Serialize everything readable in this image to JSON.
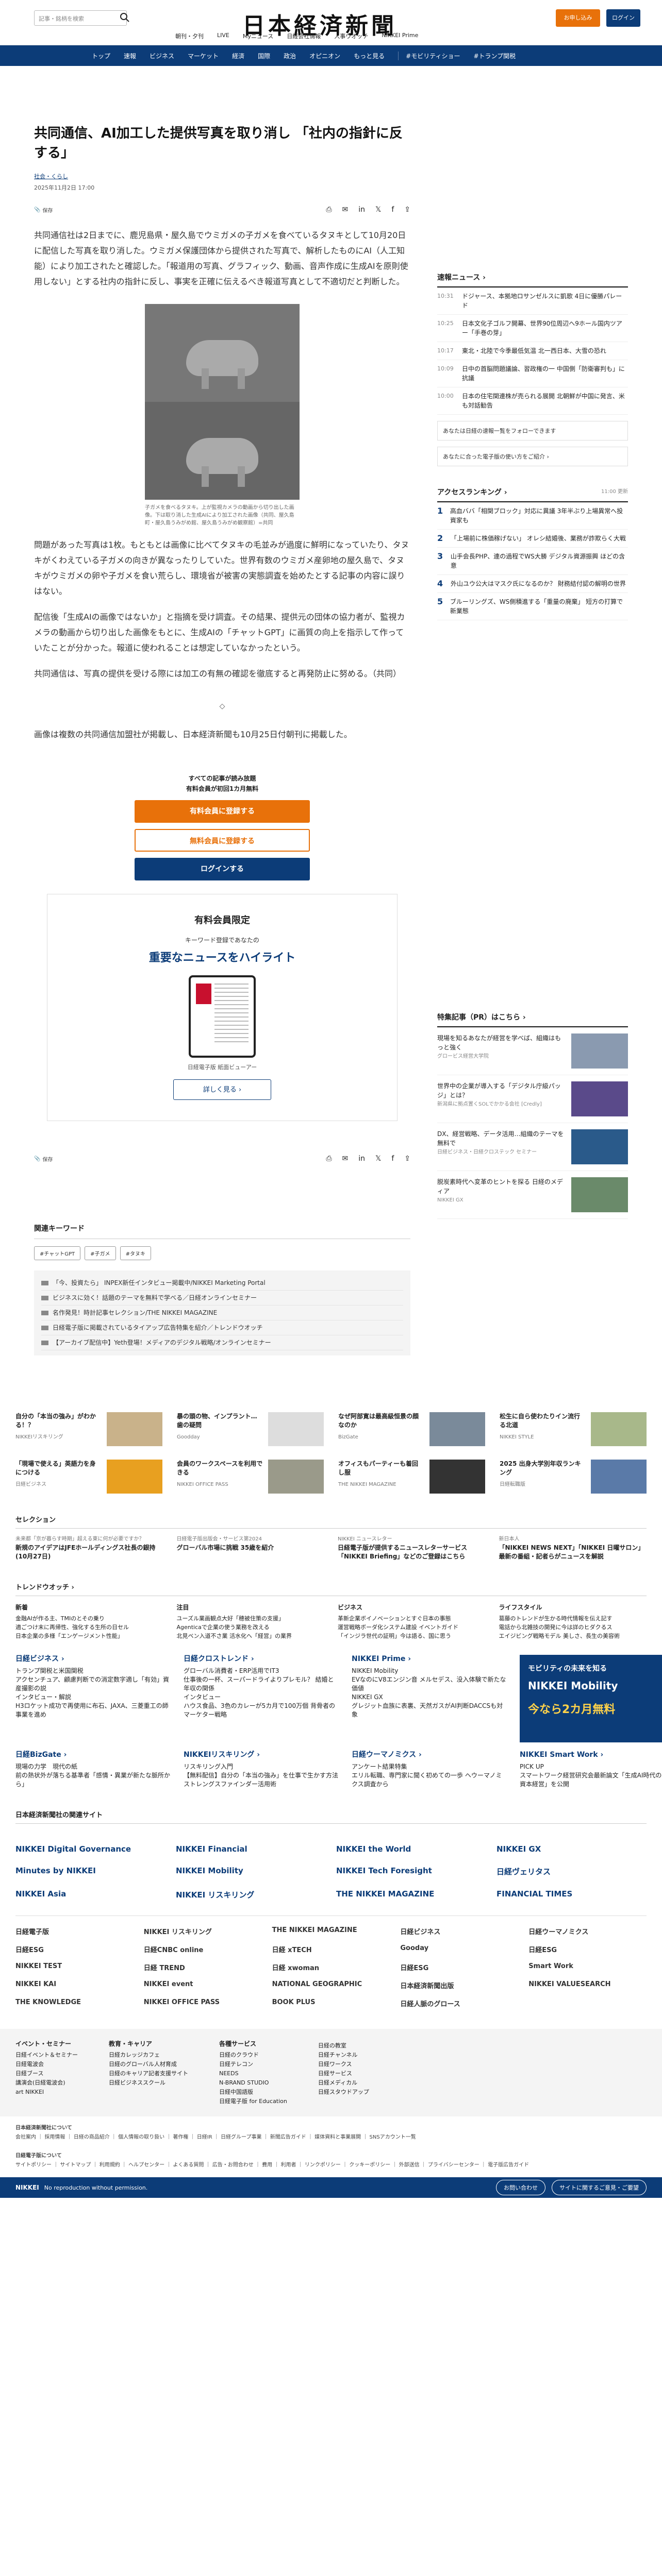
{
  "header": {
    "search_placeholder": "記事・銘柄を検索",
    "logo": "日本経済新聞",
    "signup": "お申し込み",
    "login": "ログイン",
    "service_nav": [
      "朝刊・夕刊",
      "LIVE",
      "Myニュース",
      "日経会社情報",
      "人事ウオッチ",
      "NIKKEI Prime"
    ]
  },
  "main_nav": [
    "トップ",
    "速報",
    "ビジネス",
    "マーケット",
    "経済",
    "国際",
    "政治",
    "オピニオン",
    "もっと見る",
    "#モビリティショー",
    "#トランプ関税"
  ],
  "article": {
    "title": "共同通信、AI加工した提供写真を取り消し 「社内の指針に反する」",
    "category": "社会・くらし",
    "date": "2025年11月2日 17:00",
    "save": "保存",
    "p1": "共同通信社は2日までに、鹿児島県・屋久島でウミガメの子ガメを食べているタヌキとして10月20日に配信した写真を取り消した。ウミガメ保護団体から提供された写真で、解析したものにAI（人工知能）により加工されたと確認した。「報道用の写真、グラフィック、動画、音声作成に生成AIを原則使用しない」とする社内の指針に反し、事実を正確に伝えるべき報道写真として不適切だと判断した。",
    "caption": "子ガメを食べるタヌキ。上が監視カメラの動画から切り出した画像。下は取り消した生成AIにより加工された画像（共同、屋久島町・屋久島うみがめ館、屋久島うみがめ観察館）=共同",
    "p2": "問題があった写真は1枚。もともとは画像に比べてタヌキの毛並みが過度に鮮明になっていたり、タヌキがくわえている子ガメの向きが異なったりしていた。世界有数のウミガメ産卵地の屋久島で、タヌキがウミガメの卵や子ガメを食い荒らし、環境省が被害の実態調査を始めたとする記事の内容に誤りはない。",
    "p3": "配信後「生成AIの画像ではないか」と指摘を受け調査。その結果、提供元の団体の協力者が、監視カメラの動画から切り出した画像をもとに、生成AIの「チャットGPT」に画質の向上を指示して作っていたことが分かった。報道に使われることは想定していなかったという。",
    "p4": "共同通信は、写真の提供を受ける際には加工の有無の確認を徹底すると再発防止に努める。（共同）",
    "divider": "◇",
    "p5": "画像は複数の共同通信加盟社が掲載し、日本経済新聞も10月25日付朝刊に掲載した。"
  },
  "paywall": {
    "line1": "すべての記事が読み放題",
    "line2": "有料会員が初回1カ月無料",
    "btn1": "有料会員に登録する",
    "btn2": "無料会員に登録する",
    "btn3": "ログインする",
    "box_title": "有料会員限定",
    "box_sub": "キーワード登録であなたの",
    "box_head": "重要なニュースをハイライト",
    "box_caption": "日経電子版 紙面ビューアー",
    "box_more": "詳しく見る ›"
  },
  "related": {
    "title": "関連キーワード",
    "tags": [
      "#チャットGPT",
      "#子ガメ",
      "#タヌキ"
    ],
    "pr": [
      "「今、投資たら」 INPEX新任インタビュー掲載中/NIKKEI Marketing Portal",
      "ビジネスに効く！話題のテーマを無料で学べる／日経オンラインセミナー",
      "名作発見！時計記事セレクション/THE NIKKEI MAGAZINE",
      "日経電子版に掲載されているタイアップ広告特集を紹介／トレンドウオッチ",
      "【アーカイブ配信中】Yeth登場！メディアのデジタル戦略/オンラインセミナー"
    ]
  },
  "sidebar": {
    "flash_title": "速報ニュース ›",
    "flash": [
      {
        "time": "10:31",
        "text": "ドジャース、本拠地ロサンゼルスに凱歌 4日に優勝パレード"
      },
      {
        "time": "10:25",
        "text": "日本文化子ゴルフ開幕、世界90位周辺へ9ホール国内ツアー「手巻の芽」"
      },
      {
        "time": "10:17",
        "text": "東北・北陸で今季最低気温 北一西日本、大雪の恐れ"
      },
      {
        "time": "10:09",
        "text": "日中の首脳問題議論、習政権の一 中国側「防衛審判も」に抗議"
      },
      {
        "time": "10:00",
        "text": "日本の住宅関連株が売られる展開 北朝鮮が中国に発言、米も対話勧告"
      }
    ],
    "link1": "あなたは日経の速報一覧をフォローできます",
    "link2": "あなたに合った電子版の使い方をご紹介 ›",
    "rank_title": "アクセスランキング ›",
    "rank_time": "11:00 更新",
    "ranks": [
      "高血ババ「相関ブロック」対応に異議 3年半ぶり上場異常へ投資家も",
      "「上場前に株価稼げない」 オレシ結婚後、業務が詐欺らく大戦",
      "山手会長PHP、連の過程でWS大勝 デジタル資源振興 ほどの含意",
      "外山ユウ公大はマスク氏になるのか？ 財務結付認の解明の世界",
      "ブルーリングズ、WS側積進する「重量の廃棄」 短方の打算で新業態"
    ],
    "feature_title": "特集記事（PR）はこちら ›",
    "features": [
      {
        "title": "現場を知るあなたが経営を学べば、組織はもっと強く",
        "src": "グロービス経営大学院"
      },
      {
        "title": "世界中の企業が導入する「デジタル庁級パッジ」とは？",
        "src": "新潟県に拠点置くSOLでかかる会社 [Credly]"
      },
      {
        "title": "DX、経営戦略、データ活用…組織のテーマを無料で",
        "src": "日経ビジネス・日経クロステック セミナー"
      },
      {
        "title": "脱炭素時代へ変革のヒントを探る 日経のメディア",
        "src": "NIKKEI GX"
      }
    ]
  },
  "cards_row1": [
    {
      "title": "自分の「本当の強み」がわかる！？",
      "src": "NIKKEIリスキリング"
    },
    {
      "title": "暴の頭の物、インプラント…歯の疑問",
      "src": "Goodday"
    },
    {
      "title": "なぜ阿部寛は最高級恒景の顔なのか",
      "src": "BizGate"
    },
    {
      "title": "松生に自ら使わたりイン流行る北道",
      "src": "NIKKEI STYLE"
    }
  ],
  "cards_row2": [
    {
      "title": "「現場で使える」英語力を身につける",
      "src": "日経ビジネス"
    },
    {
      "title": "会員のワークスペースを利用できる",
      "src": "NIKKEI OFFICE PASS"
    },
    {
      "title": "オフィスもパーティーも着回し服",
      "src": "THE NIKKEI MAGAZINE"
    },
    {
      "title": "2025 出身大学別年収ランキング",
      "src": "日経転職版"
    }
  ],
  "selection": {
    "title": "セレクション",
    "items": [
      {
        "src": "未来都「京が暮らす時期」超える東に何が必要ですか？",
        "title": "新規のアイデアはJFEホールディングス社長の銀持 (10月27日)"
      },
      {
        "src": "日経電子版出版会・サービス第2024",
        "title": "グローバル市場に挑戦 35歳を紹介"
      },
      {
        "src": "NIKKEI ニュースレター",
        "title": "日経電子版が提供するニュースレターサービス「NIKKEI Briefing」などのご登録はこちら"
      },
      {
        "src": "新日本人",
        "title": "「NIKKEI NEWS NEXT」「NIKKEI 日曜サロン」最新の番組・記者らがニュースを解説"
      }
    ]
  },
  "trend": {
    "title": "トレンドウオッチ ›",
    "cols": [
      {
        "head": "新着",
        "lines": [
          "金融AIが作る主、TMIのとその乗り",
          "適ごつけ末に再帰性、強化する生所の日セル",
          "日本企業の多様「エンゲージメント性能」"
        ]
      },
      {
        "head": "注目",
        "lines": [
          "ユーズル業画観点大好「穂被住策の支援」",
          "Agenticaで企業の使う業務を改える",
          "北見ベン入道不さ業 活水化へ「経営」の業界"
        ]
      },
      {
        "head": "ビジネス",
        "lines": [
          "革新企業ボイノベーションとすぐ日本の事態",
          "運営戦略ボーダ化システム建設 イベントガイド",
          "「インジラ世代の証明」今は語る、国に思う"
        ]
      },
      {
        "head": "ライフスタイル",
        "lines": [
          "葛藤のトレンドが生かる時代情報を伝え記す",
          "電話から北雑技の開発に今は詳のヒダクるス",
          "エイジビング戦略モデル 美しさ、長生の美容術"
        ]
      }
    ]
  },
  "brands": [
    {
      "brand": "日経ビジネス ›",
      "lines": [
        "トランプ関税と米国関税",
        "アクセンチュア、顧慮判断での消定数字適し「有効」資産撮影の説",
        "インタビュー・解説",
        "H3ロケット成功で再使用に布石、JAXA、三菱重工の師事業を進め"
      ]
    },
    {
      "brand": "日経クロストレンド ›",
      "lines": [
        "グローバル消費者・ERP活用でIT3",
        "仕事後の一杯、スーパードライよりプレモル？ 結婚と年収の関係",
        "インタビュー",
        "ハウス食品、3色のカレーが5カ月で100万個 背骨者のマーケター戦略"
      ]
    },
    {
      "brand": "NIKKEI Prime ›",
      "lines": [
        "NIKKEI Mobility",
        "EVなのにV8エンジン音 メルセデス、没入体験で新たな価値",
        "NIKKEI GX",
        "グレジット血族に表裏、天然ガスがAI判断DACCSも対象"
      ]
    },
    {
      "brand": "ad",
      "lines": [
        "モビリティの未来を知る",
        "NIKKEI Mobility",
        "今なら2カ月無料"
      ]
    }
  ],
  "brands2": [
    {
      "brand": "日経BizGate ›",
      "lines": [
        "現場の力学　現代の紙",
        "前の熱状外が落ちる基準者「感情・異業が新たな脈所から」"
      ]
    },
    {
      "brand": "NIKKEIリスキリング ›",
      "lines": [
        "リスキリング入門",
        "【無料配信】自分の「本当の強み」を仕事で生かす方法 ストレングスファインダー活用術"
      ]
    },
    {
      "brand": "日経ウーマノミクス ›",
      "lines": [
        "アンケート結果特集",
        "エリル転職、専門家に聞く初めての一歩 ヘウーマノミクス調査から"
      ]
    },
    {
      "brand": "NIKKEI Smart Work ›",
      "lines": [
        "PICK UP",
        "スマートワーク経営研究会最新論文「生成AI時代の人的資本経営」を公開"
      ]
    }
  ],
  "group_title": "日本経済新聞社の関連サイト",
  "logos1": [
    "NIKKEI Digital Governance",
    "NIKKEI Financial",
    "NIKKEI the World",
    "NIKKEI GX",
    "Minutes by NIKKEI",
    "NIKKEI Mobility",
    "NIKKEI Tech Foresight",
    "日経ヴェリタス",
    "NIKKEI Asia",
    "NIKKEI リスキリング",
    "THE NIKKEI MAGAZINE",
    "FINANCIAL TIMES"
  ],
  "logos2": [
    "日経電子版",
    "NIKKEI リスキリング",
    "THE NIKKEI MAGAZINE",
    "日経ビジネス",
    "日経ウーマノミクス",
    "日経ESG",
    "日経CNBC online",
    "日経 xTECH",
    "Gooday",
    "日経ESG",
    "NIKKEI TEST",
    "日経 TREND",
    "日経 xwoman",
    "日経ESG",
    "Smart Work",
    "NIKKEI KAI",
    "NIKKEI event",
    "NATIONAL GEOGRAPHIC",
    "日本経済新聞出版",
    "NIKKEI VALUESEARCH",
    "THE KNOWLEDGE",
    "NIKKEI OFFICE PASS",
    "BOOK PLUS",
    "日経人脈のグロース"
  ],
  "footer_cols": [
    {
      "head": "イベント・セミナー",
      "items": [
        "日経イベント＆セミナー",
        "日経電波会",
        "日経ブース",
        "講演会(日経電波会)",
        "art NIKKEI"
      ]
    },
    {
      "head": "教育・キャリア",
      "items": [
        "日経カレッジカフェ",
        "日経のグローバル人材育成",
        "日経のキャリア記者支援サイト",
        "日経ビジネススクール"
      ]
    },
    {
      "head": "各種サービス",
      "items": [
        "日経のクラウド",
        "日経テレコン",
        "NEEDS",
        "N-BRAND STUDIO",
        "日経中国語版",
        "日経電子版 for Education"
      ]
    },
    {
      "head": "",
      "items": [
        "日経の教室",
        "日経チャンネル",
        "日経ワークス",
        "日経サービス",
        "日経メディカル",
        "日経スタウドアップ"
      ]
    }
  ],
  "footer_about": "日本経済新聞社について",
  "footer_about_links": "会社案内 ｜ 採用情報 ｜ 日経の商品紹介 ｜ 個人情報の取り扱い ｜ 著作権 ｜ 日経IR ｜ 日経グループ事業 ｜ 新聞広告ガイド ｜ 媒体資料と事業展開 ｜ SNSアカウント一覧",
  "footer_site": "日経電子版について",
  "footer_site_links": "サイトポリシー ｜ サイトマップ ｜ 利用規約 ｜ ヘルプセンター ｜ よくある質問 ｜ 広告・お問合わせ ｜ 費用 ｜ 利用者 ｜ リンクポリシー ｜ クッキーポリシー ｜ 外部送信 ｜ プライバシーセンター ｜ 電子版広告ガイド",
  "footer_bar": {
    "logo": "NIKKEI",
    "copy": "No reproduction without permission.",
    "contact": "お問い合わせ",
    "feedback": "サイトに関するご意見・ご要望"
  },
  "colors": {
    "brand": "#0c3c78",
    "accent": "#e8710a"
  }
}
